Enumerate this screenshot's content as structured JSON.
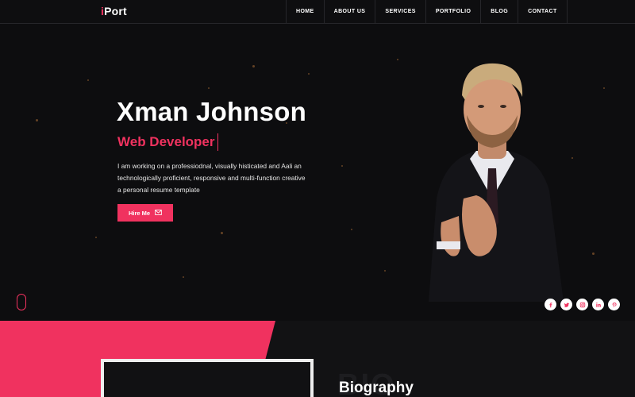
{
  "brand": {
    "logo_accent": "i",
    "logo_rest": "Port",
    "accent_color": "#f0325f"
  },
  "nav": {
    "items": [
      {
        "label": "HOME"
      },
      {
        "label": "ABOUT US"
      },
      {
        "label": "SERVICES"
      },
      {
        "label": "PORTFOLIO"
      },
      {
        "label": "BLOG"
      },
      {
        "label": "CONTACT"
      }
    ]
  },
  "hero": {
    "name": "Xman Johnson",
    "role": "Web Developer",
    "description": "I am working on a professiodnal, visually histicated and Aali an technologically proficient, responsive and multi-function creative a personal resume template",
    "button_label": "Hire Me",
    "button_icon": "envelope-icon"
  },
  "social": [
    {
      "icon": "facebook-icon",
      "glyph": "f"
    },
    {
      "icon": "twitter-icon",
      "glyph": "t"
    },
    {
      "icon": "instagram-icon",
      "glyph": "◎"
    },
    {
      "icon": "linkedin-icon",
      "glyph": "in"
    },
    {
      "icon": "pinterest-icon",
      "glyph": "p"
    }
  ],
  "biography": {
    "background_word": "BIO",
    "title": "Biography"
  }
}
